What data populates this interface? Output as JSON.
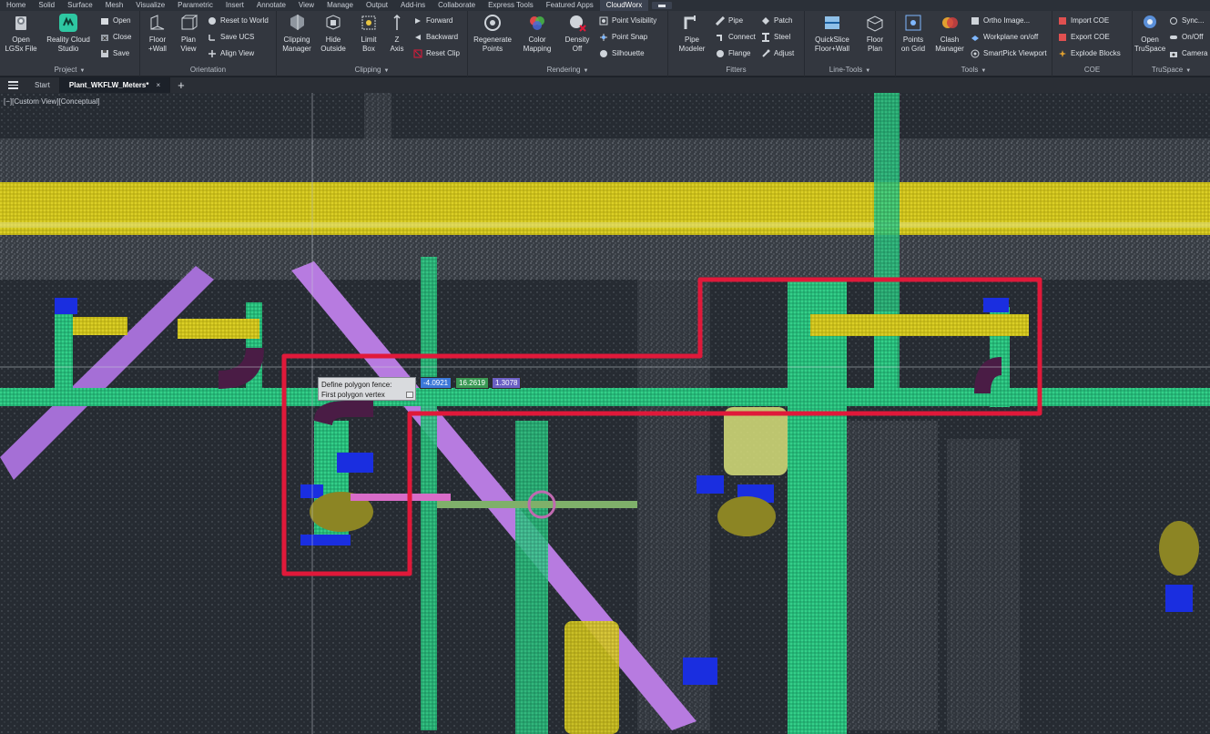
{
  "menu_tabs": [
    {
      "label": "Home"
    },
    {
      "label": "Solid"
    },
    {
      "label": "Surface"
    },
    {
      "label": "Mesh"
    },
    {
      "label": "Visualize"
    },
    {
      "label": "Parametric"
    },
    {
      "label": "Insert"
    },
    {
      "label": "Annotate"
    },
    {
      "label": "View"
    },
    {
      "label": "Manage"
    },
    {
      "label": "Output"
    },
    {
      "label": "Add-ins"
    },
    {
      "label": "Collaborate"
    },
    {
      "label": "Express Tools"
    },
    {
      "label": "Featured Apps"
    },
    {
      "label": "CloudWorx"
    }
  ],
  "active_tab": "CloudWorx",
  "ribbon": {
    "project": {
      "title": "Project",
      "open_lgsx": "Open\nLGSx File",
      "reality_cloud": "Reality Cloud\nStudio",
      "open": "Open",
      "close": "Close",
      "save": "Save"
    },
    "orientation": {
      "title": "Orientation",
      "floor_wall": "Floor\n+Wall",
      "plan_view": "Plan\nView",
      "reset_world": "Reset to World",
      "save_ucs": "Save UCS",
      "align_view": "Align View"
    },
    "clipping": {
      "title": "Clipping",
      "clip_manager": "Clipping\nManager",
      "hide_outside": "Hide\nOutside",
      "limit_box": "Limit\nBox",
      "z_axis": "Z\nAxis",
      "forward": "Forward",
      "backward": "Backward",
      "reset_clip": "Reset Clip"
    },
    "rendering": {
      "title": "Rendering",
      "regen": "Regenerate\nPoints",
      "color_map": "Color\nMapping",
      "density": "Density\nOff",
      "point_vis": "Point Visibility",
      "point_snap": "Point Snap",
      "silhouette": "Silhouette"
    },
    "fitters": {
      "title": "Fitters",
      "pipe_modeler": "Pipe\nModeler",
      "pipe": "Pipe",
      "connect": "Connect",
      "flange": "Flange",
      "patch": "Patch",
      "steel": "Steel",
      "adjust": "Adjust"
    },
    "line_tools": {
      "title": "Line-Tools",
      "quickslice": "QuickSlice\nFloor+Wall",
      "floor_plan": "Floor\nPlan"
    },
    "tools": {
      "title": "Tools",
      "points_grid": "Points\non Grid",
      "clash": "Clash\nManager",
      "ortho": "Ortho Image...",
      "workplane": "Workplane on/off",
      "smartpick": "SmartPick Viewport"
    },
    "coe": {
      "title": "COE",
      "import": "Import COE",
      "export": "Export COE",
      "explode": "Explode Blocks"
    },
    "truspace": {
      "title": "TruSpace",
      "open": "Open\nTruSpace",
      "sync": "Sync...",
      "onoff": "On/Off",
      "camera": "Camera"
    }
  },
  "file_tabs": {
    "start": "Start",
    "active": "Plant_WKFLW_Meters*",
    "close_glyph": "×",
    "add_glyph": "+"
  },
  "viewport": {
    "label": "[−][Custom View][Conceptual]",
    "prompt_line1": "Define polygon fence:",
    "prompt_line2": "First polygon vertex",
    "coord_x": "-4.0921",
    "coord_y": "16.2619",
    "coord_z": "1.3078"
  },
  "colors": {
    "fence": "#e0193a",
    "yellow_cloud": "#e3d61f",
    "green_cloud": "#2fd98a",
    "purple_cloud": "#b77be0",
    "blue_cloud": "#1a2ee0",
    "coord_x_bg": "#3b78d8",
    "coord_y_bg": "#3a9a55",
    "coord_z_bg": "#6a5fc4"
  }
}
